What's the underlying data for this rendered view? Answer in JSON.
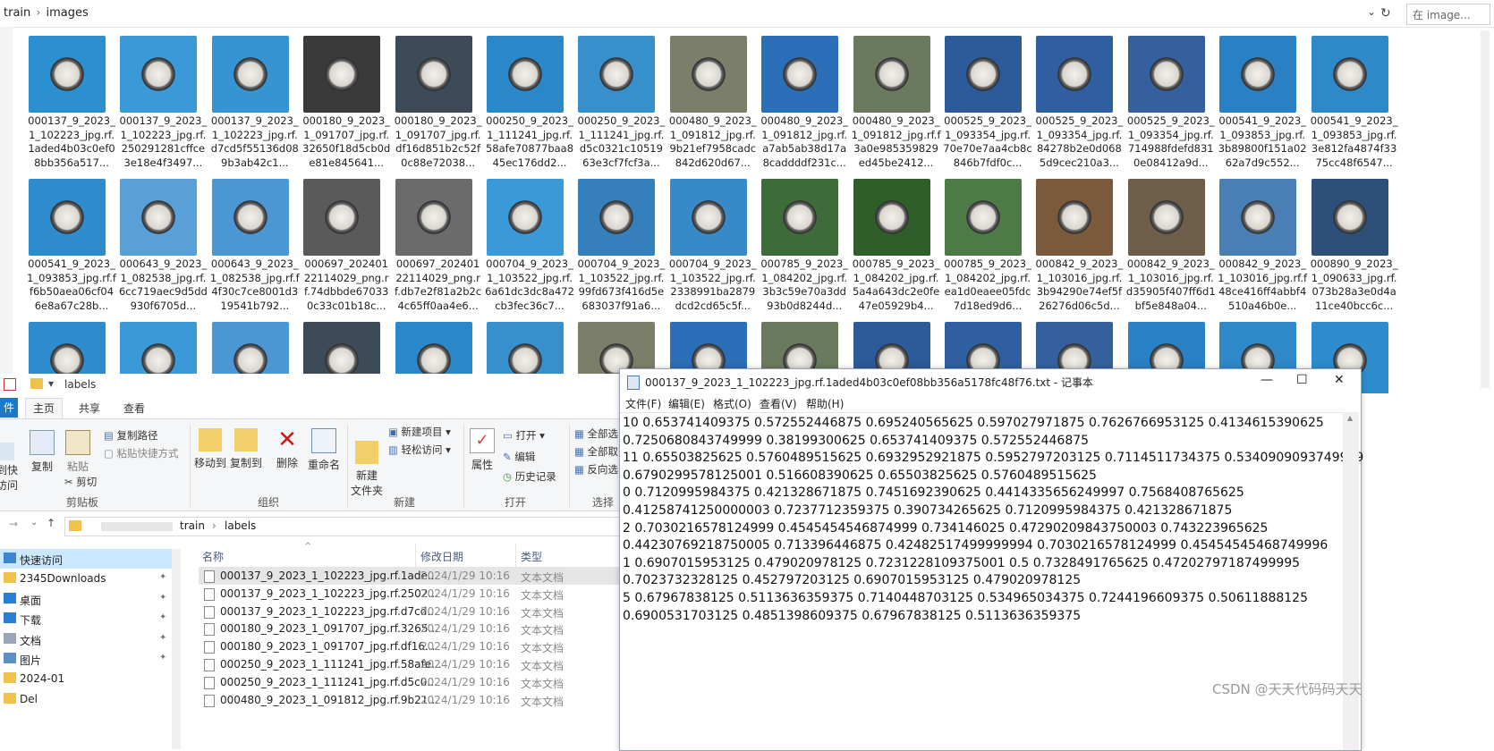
{
  "top_explorer": {
    "breadcrumb": [
      "train",
      "images"
    ],
    "search_placeholder": "在 image...",
    "thumbnails": [
      {
        "caption": "000137_9_2023_1_102223_jpg.rf.1aded4b03c0ef08bb356a517...",
        "color": "#2c8fd0"
      },
      {
        "caption": "000137_9_2023_1_102223_jpg.rf.250291281cffce3e18e4f3497...",
        "color": "#3a9ad8"
      },
      {
        "caption": "000137_9_2023_1_102223_jpg.rf.d7cd5f55136d089b3ab42c1...",
        "color": "#3794d2"
      },
      {
        "caption": "000180_9_2023_1_091707_jpg.rf.32650f18d5cb0de81e845641...",
        "color": "#3a3a3a"
      },
      {
        "caption": "000180_9_2023_1_091707_jpg.rf.df16d851b2c52f0c88e72038...",
        "color": "#3d4a57"
      },
      {
        "caption": "000250_9_2023_1_111241_jpg.rf.58afe70877baa845ec176dd2...",
        "color": "#2a87c8"
      },
      {
        "caption": "000250_9_2023_1_111241_jpg.rf.d5c0321c1051963e3cf7fcf3a...",
        "color": "#3790cc"
      },
      {
        "caption": "000480_9_2023_1_091812_jpg.rf.9b21ef7958cadc842d620d67...",
        "color": "#7b7f6a"
      },
      {
        "caption": "000480_9_2023_1_091812_jpg.rf.a7ab5ab38d17a8caddddf231c...",
        "color": "#2b6fb8"
      },
      {
        "caption": "000480_9_2023_1_091812_jpg.rf.f3a0e985359829ed45be2412...",
        "color": "#6b7a5e"
      },
      {
        "caption": "000525_9_2023_1_093354_jpg.rf.70e70e7aa4cb8c846b7fdf0c...",
        "color": "#2d5a9a"
      },
      {
        "caption": "000525_9_2023_1_093354_jpg.rf.84278b2e0d0685d9cec210a3...",
        "color": "#2f5fa0"
      },
      {
        "caption": "000525_9_2023_1_093354_jpg.rf.714988fdefd8310e08412a9d...",
        "color": "#34619e"
      },
      {
        "caption": "000541_9_2023_1_093853_jpg.rf.3b89800f151a0262a7d9c552...",
        "color": "#2a80c4"
      },
      {
        "caption": "000541_9_2023_1_093853_jpg.rf.3e812fa4874f3375cc48f6547...",
        "color": "#2f88c8"
      },
      {
        "caption": "000541_9_2023_1_093853_jpg.rf.ff6b50aea06cf046e8a67c28b...",
        "color": "#2e8ccc"
      },
      {
        "caption": "000643_9_2023_1_082538_jpg.rf.6cc719aec9d5dd930f6705d...",
        "color": "#5aa0d8"
      },
      {
        "caption": "000643_9_2023_1_082538_jpg.rf.f4f30c7ce8001d319541b792...",
        "color": "#4a97d4"
      },
      {
        "caption": "000697_20240122114029_png.rf.74dbbde670330c33c01b18c...",
        "color": "#5a5a5a"
      },
      {
        "caption": "000697_20240122114029_png.rf.db7e2f81a2b2c4c65ff0aa4e6...",
        "color": "#6b6b6b"
      },
      {
        "caption": "000704_9_2023_1_103522_jpg.rf.6a61dc3dc8a472cb3fec36c7...",
        "color": "#3a9ad8"
      },
      {
        "caption": "000704_9_2023_1_103522_jpg.rf.99fd673f416d5e683037f91a6...",
        "color": "#357fbd"
      },
      {
        "caption": "000704_9_2023_1_103522_jpg.rf.2338991ba2879dcd2cd65c5f...",
        "color": "#3889c8"
      },
      {
        "caption": "000785_9_2023_1_084202_jpg.rf.3b3c59e70a3dd93b0d8244d...",
        "color": "#3e6b3a"
      },
      {
        "caption": "000785_9_2023_1_084202_jpg.rf.5a4a643dc2e0fe47e05929b4...",
        "color": "#2f5e2b"
      },
      {
        "caption": "000785_9_2023_1_084202_jpg.rf.ea1d0eaee05fdc7d18ed9d6...",
        "color": "#4e7a48"
      },
      {
        "caption": "000842_9_2023_1_103016_jpg.rf.3b94290e74ef5f26276d06c5d...",
        "color": "#7a5a3a"
      },
      {
        "caption": "000842_9_2023_1_103016_jpg.rf.d35905f407ff6d1bf5e848a04...",
        "color": "#6e5d48"
      },
      {
        "caption": "000842_9_2023_1_103016_jpg.rf.f48ce416ff4abbf4510a46b0e...",
        "color": "#4a7fb5"
      },
      {
        "caption": "000890_9_2023_1_090633_jpg.rf.073b28a3e0d4a11ce40bcc6c...",
        "color": "#2e4f7a"
      }
    ],
    "third_row_colors": [
      "#2e8ccc",
      "#3a9ad8",
      "#4a97d4",
      "#3d4a57",
      "#2a87c8",
      "#3790cc",
      "#7b7f6a",
      "#2b6fb8",
      "#6b7a5e",
      "#2d5a9a",
      "#2f5fa0",
      "#34619e",
      "#2a80c4",
      "#2f88c8",
      "#2e8ccc"
    ]
  },
  "bottom_explorer": {
    "window_title": "labels",
    "tabs": [
      "件",
      "主页",
      "共享",
      "查看"
    ],
    "ribbon": {
      "pin_quick": "到快\n访问",
      "copy": "复制",
      "paste": "粘贴",
      "copy_path": "复制路径",
      "paste_shortcut": "粘贴快捷方式",
      "cut": "剪切",
      "group_clipboard": "剪贴板",
      "move_to": "移动到",
      "copy_to": "复制到",
      "delete": "删除",
      "rename": "重命名",
      "group_organize": "组织",
      "new_folder": "新建\n文件夹",
      "new_item": "新建项目",
      "easy_access": "轻松访问",
      "group_new": "新建",
      "properties": "属性",
      "open": "打开",
      "edit": "编辑",
      "history": "历史记录",
      "group_open": "打开",
      "select_all": "全部选",
      "select_none": "全部取",
      "invert": "反向选",
      "group_select": "选择"
    },
    "address": [
      "train",
      "labels"
    ],
    "nav_items": [
      {
        "label": "快速访问",
        "icon": "star-icon",
        "pinned": false
      },
      {
        "label": "2345Downloads",
        "icon": "folder-icon",
        "pinned": true
      },
      {
        "label": "桌面",
        "icon": "desktop-icon",
        "pinned": true
      },
      {
        "label": "下载",
        "icon": "download-icon",
        "pinned": true
      },
      {
        "label": "文档",
        "icon": "document-icon",
        "pinned": true
      },
      {
        "label": "图片",
        "icon": "picture-icon",
        "pinned": true
      },
      {
        "label": "2024-01",
        "icon": "folder-icon",
        "pinned": false
      },
      {
        "label": "Del",
        "icon": "folder-icon",
        "pinned": false
      }
    ],
    "columns": {
      "name": "名称",
      "date": "修改日期",
      "type": "类型"
    },
    "files": [
      {
        "name": "000137_9_2023_1_102223_jpg.rf.1ade...",
        "date": "2024/1/29 10:16",
        "type": "文本文档",
        "selected": true
      },
      {
        "name": "000137_9_2023_1_102223_jpg.rf.2502...",
        "date": "2024/1/29 10:16",
        "type": "文本文档",
        "selected": false
      },
      {
        "name": "000137_9_2023_1_102223_jpg.rf.d7cd...",
        "date": "2024/1/29 10:16",
        "type": "文本文档",
        "selected": false
      },
      {
        "name": "000180_9_2023_1_091707_jpg.rf.3265...",
        "date": "2024/1/29 10:16",
        "type": "文本文档",
        "selected": false
      },
      {
        "name": "000180_9_2023_1_091707_jpg.rf.df16...",
        "date": "2024/1/29 10:16",
        "type": "文本文档",
        "selected": false
      },
      {
        "name": "000250_9_2023_1_111241_jpg.rf.58afe...",
        "date": "2024/1/29 10:16",
        "type": "文本文档",
        "selected": false
      },
      {
        "name": "000250_9_2023_1_111241_jpg.rf.d5c0...",
        "date": "2024/1/29 10:16",
        "type": "文本文档",
        "selected": false
      },
      {
        "name": "000480_9_2023_1_091812_jpg.rf.9b21...",
        "date": "2024/1/29 10:16",
        "type": "文本文档",
        "selected": false
      }
    ]
  },
  "notepad": {
    "title": "000137_9_2023_1_102223_jpg.rf.1aded4b03c0ef08bb356a5178fc48f76.txt - 记事本",
    "menu": [
      "文件(F)",
      "编辑(E)",
      "格式(O)",
      "查看(V)",
      "帮助(H)"
    ],
    "lines": [
      "10 0.653741409375 0.572552446875 0.695240565625 0.597027971875 0.7626766953125 0.4134615390625",
      "0.7250680843749999 0.38199300625 0.653741409375 0.572552446875",
      "11 0.65503825625 0.5760489515625 0.6932952921875 0.5952797203125 0.7114511734375 0.5340909093749999",
      "0.6790299578125001 0.516608390625 0.65503825625 0.5760489515625",
      "0 0.7120995984375 0.421328671875 0.7451692390625 0.4414335656249997 0.7568408765625",
      "0.41258741250000003 0.7237712359375 0.390734265625 0.7120995984375 0.421328671875",
      "2 0.7030216578124999 0.4545454546874999 0.734146025 0.47290209843750003 0.743223965625",
      "0.44230769218750005 0.713396446875 0.42482517499999994 0.7030216578124999 0.45454545468749996",
      "1 0.6907015953125 0.479020978125 0.7231228109375001 0.5 0.7328491765625 0.47202797187499995",
      "0.7023732328125 0.452797203125 0.6907015953125 0.479020978125",
      "5 0.67967838125 0.5113636359375 0.7140448703125 0.534965034375 0.7244196609375 0.50611888125",
      "0.6900531703125 0.4851398609375 0.67967838125 0.5113636359375"
    ]
  },
  "watermark": "CSDN @天天代码码天天"
}
